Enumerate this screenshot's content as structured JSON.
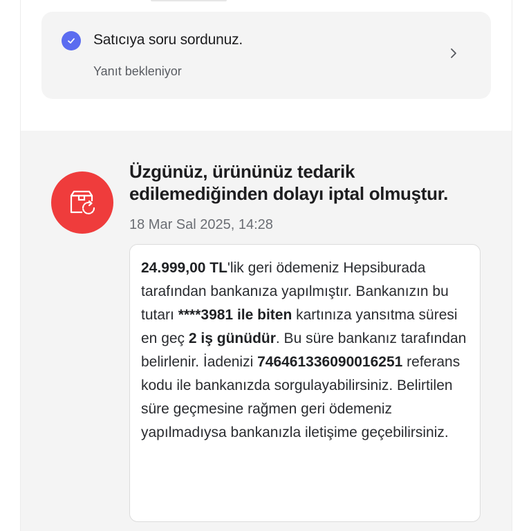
{
  "question": {
    "title": "Satıcıya soru sordunuz.",
    "status": "Yanıt bekleniyor",
    "check_icon": "check-icon",
    "chevron_icon": "chevron-right-icon"
  },
  "cancellation": {
    "icon": "box-refresh-icon",
    "title": "Üzgünüz, ürününüz tedarik edilemediğinden dolayı iptal olmuştur.",
    "date": "18 Mar Sal 2025, 14:28",
    "message": {
      "amount": "24.999,00 TL",
      "p1": "'lik geri ödemeniz Hepsiburada tarafından bankanıza yapılmıştır. Bankanızın bu tutarı ",
      "card": "****3981 ile biten",
      "p2": " kartınıza yansıtma süresi en geç ",
      "days": "2 iş günüdür",
      "p3": ". Bu süre bankanız tarafından belirlenir. İadenizi ",
      "reference": "746461336090016251",
      "p4": " referans kodu ile bankanızda sorgulayabilirsiniz. Belirtilen süre geçmesine rağmen geri ödemeniz yapılmadıysa bankanızla iletişime geçebilirsiniz."
    }
  },
  "colors": {
    "accent_blue": "#5b6cf0",
    "cancel_red": "#ef3c3c",
    "section_bg": "#f4f4f4"
  }
}
